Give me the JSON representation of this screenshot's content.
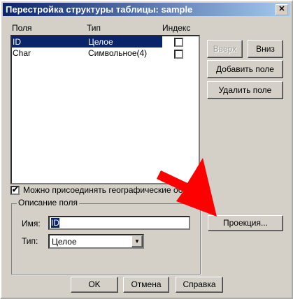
{
  "title": "Перестройка структуры таблицы: sample",
  "close_label": "✕",
  "columns": {
    "fields": "Поля",
    "type": "Тип",
    "index": "Индекс"
  },
  "rows": [
    {
      "name": "ID",
      "type": "Целое",
      "index": false,
      "selected": true
    },
    {
      "name": "Char",
      "type": "Символьное(4)",
      "index": false,
      "selected": false
    }
  ],
  "buttons": {
    "up": "Вверх",
    "down": "Вниз",
    "add": "Добавить поле",
    "remove": "Удалить поле",
    "projection": "Проекция...",
    "ok": "OK",
    "cancel": "Отмена",
    "help": "Справка"
  },
  "geo_checkbox": {
    "label": "Можно присоединять географические объекты",
    "checked": true
  },
  "field_group": {
    "legend": "Описание поля",
    "name_label": "Имя:",
    "name_value": "ID",
    "type_label": "Тип:",
    "type_value": "Целое"
  },
  "colors": {
    "selection": "#0a246a",
    "arrow": "#ff0000"
  }
}
